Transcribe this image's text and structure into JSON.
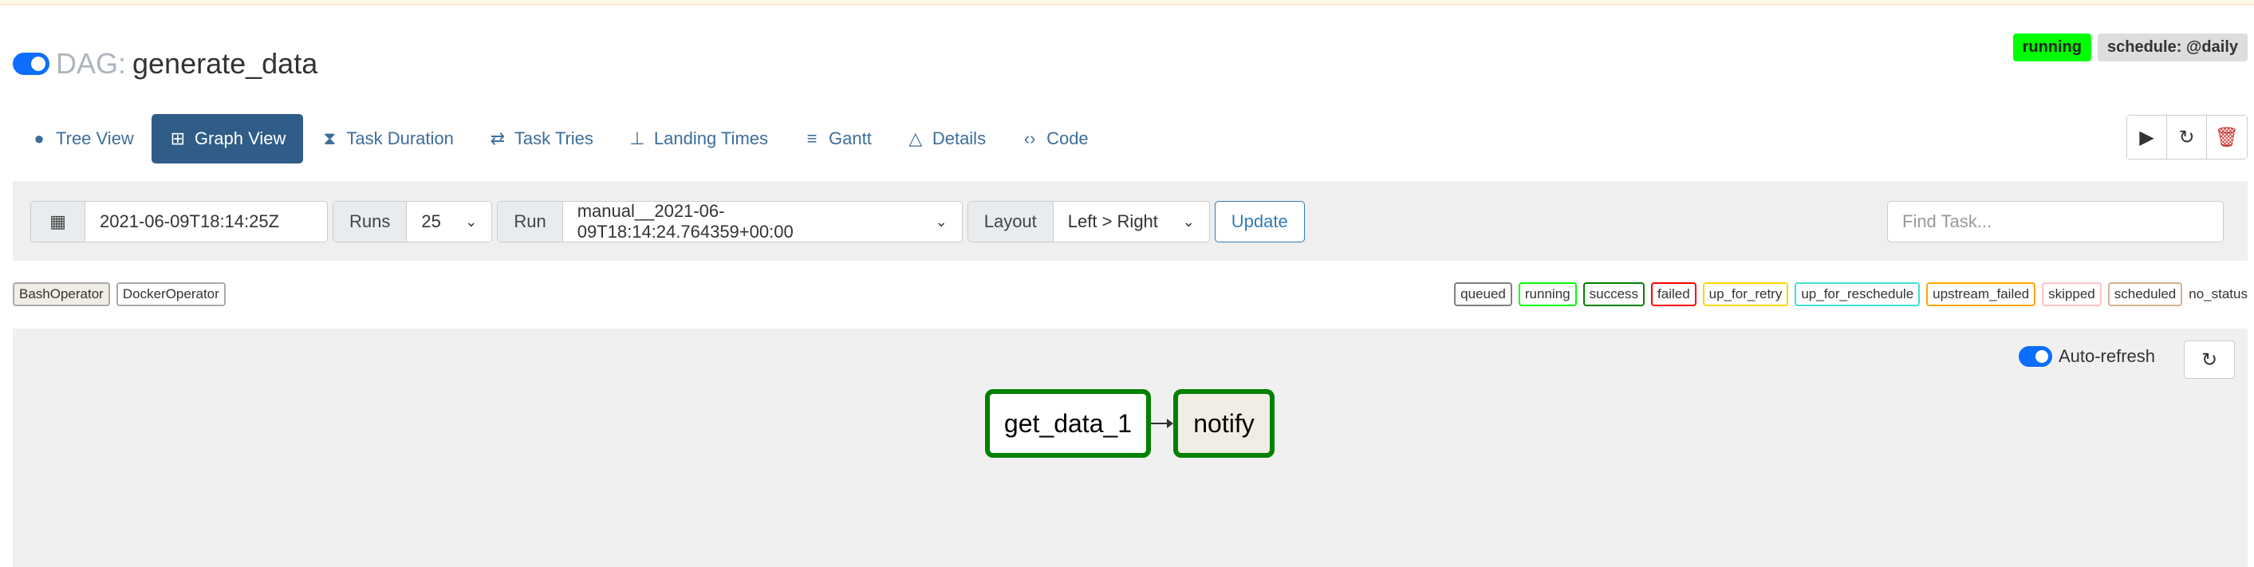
{
  "dag": {
    "label": "DAG:",
    "name": "generate_data"
  },
  "badges": {
    "state": "running",
    "schedule": "schedule: @daily"
  },
  "tabs": [
    {
      "label": "Tree View",
      "icon": "tree-icon"
    },
    {
      "label": "Graph View",
      "icon": "graph-icon"
    },
    {
      "label": "Task Duration",
      "icon": "hourglass-icon"
    },
    {
      "label": "Task Tries",
      "icon": "retry-icon"
    },
    {
      "label": "Landing Times",
      "icon": "landing-icon"
    },
    {
      "label": "Gantt",
      "icon": "gantt-icon"
    },
    {
      "label": "Details",
      "icon": "warning-icon"
    },
    {
      "label": "Code",
      "icon": "code-icon"
    }
  ],
  "filters": {
    "base_date": "2021-06-09T18:14:25Z",
    "runs_label": "Runs",
    "runs_value": "25",
    "run_label": "Run",
    "run_value": "manual__2021-06-09T18:14:24.764359+00:00",
    "layout_label": "Layout",
    "layout_value": "Left > Right",
    "update_label": "Update",
    "find_placeholder": "Find Task..."
  },
  "operators": [
    "BashOperator",
    "DockerOperator"
  ],
  "operator_colors": {
    "BashOperator": "#f0ede4",
    "DockerOperator": "#ffffff"
  },
  "legend": [
    {
      "label": "queued",
      "color": "#808080"
    },
    {
      "label": "running",
      "color": "#00ff00"
    },
    {
      "label": "success",
      "color": "#008000"
    },
    {
      "label": "failed",
      "color": "#ff0000"
    },
    {
      "label": "up_for_retry",
      "color": "#ffd700"
    },
    {
      "label": "up_for_reschedule",
      "color": "#40e0d0"
    },
    {
      "label": "upstream_failed",
      "color": "#ffa500"
    },
    {
      "label": "skipped",
      "color": "#ffc0cb"
    },
    {
      "label": "scheduled",
      "color": "#d2b48c"
    },
    {
      "label": "no_status",
      "color": ""
    }
  ],
  "graph": {
    "autorefresh_label": "Auto-refresh",
    "nodes": [
      {
        "id": "get_data_1",
        "state": "success"
      },
      {
        "id": "notify",
        "state": "success"
      }
    ]
  }
}
